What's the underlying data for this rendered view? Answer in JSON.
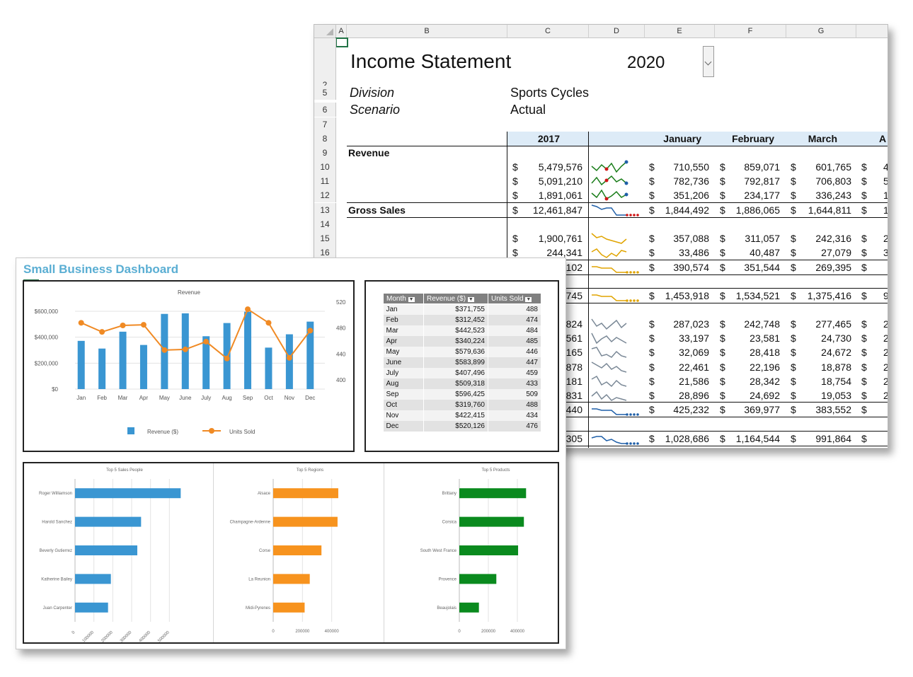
{
  "spreadsheet": {
    "columns": [
      "A",
      "B",
      "C",
      "D",
      "E",
      "F",
      "G"
    ],
    "title": "Income Statement",
    "year": "2020",
    "division_label": "Division",
    "division_value": "Sports Cycles",
    "scenario_label": "Scenario",
    "scenario_value": "Actual",
    "row_numbers": [
      "2",
      "5",
      "6",
      "7",
      "8",
      "9",
      "10",
      "11",
      "12",
      "13",
      "14",
      "15",
      "16"
    ],
    "col_year": "2017",
    "months": [
      "January",
      "February",
      "March",
      "A"
    ],
    "revenue_label": "Revenue",
    "gross_sales_label": "Gross Sales",
    "currency": "$",
    "rows": [
      {
        "total": "5,479,576",
        "jan": "710,550",
        "feb": "859,071",
        "mar": "601,765",
        "apr": "4"
      },
      {
        "total": "5,091,210",
        "jan": "782,736",
        "feb": "792,817",
        "mar": "706,803",
        "apr": "5"
      },
      {
        "total": "1,891,061",
        "jan": "351,206",
        "feb": "234,177",
        "mar": "336,243",
        "apr": "1"
      },
      {
        "total": "12,461,847",
        "jan": "1,844,492",
        "feb": "1,886,065",
        "mar": "1,644,811",
        "apr": "1,"
      },
      {
        "total": "1,900,761",
        "jan": "357,088",
        "feb": "311,057",
        "mar": "242,316",
        "apr": "2"
      },
      {
        "total": "244,341",
        "jan": "33,486",
        "feb": "40,487",
        "mar": "27,079",
        "apr": "3"
      },
      {
        "total": "102",
        "jan": "390,574",
        "feb": "351,544",
        "mar": "269,395",
        "apr": ""
      },
      {
        "total": "745",
        "jan": "1,453,918",
        "feb": "1,534,521",
        "mar": "1,375,416",
        "apr": "9"
      },
      {
        "total": "824",
        "jan": "287,023",
        "feb": "242,748",
        "mar": "277,465",
        "apr": "2"
      },
      {
        "total": "561",
        "jan": "33,197",
        "feb": "23,581",
        "mar": "24,730",
        "apr": "2"
      },
      {
        "total": "165",
        "jan": "32,069",
        "feb": "28,418",
        "mar": "24,672",
        "apr": "2"
      },
      {
        "total": "878",
        "jan": "22,461",
        "feb": "22,196",
        "mar": "18,878",
        "apr": "2"
      },
      {
        "total": "181",
        "jan": "21,586",
        "feb": "28,342",
        "mar": "18,754",
        "apr": "2"
      },
      {
        "total": "831",
        "jan": "28,896",
        "feb": "24,692",
        "mar": "19,053",
        "apr": "2"
      },
      {
        "total": "440",
        "jan": "425,232",
        "feb": "369,977",
        "mar": "383,552",
        "apr": ""
      },
      {
        "total": "305",
        "jan": "1,028,686",
        "feb": "1,164,544",
        "mar": "991,864",
        "apr": ""
      }
    ]
  },
  "dashboard": {
    "title": "Small Business Dashboard",
    "table_headers": [
      "Month",
      "Revenue ($)",
      "Units Sold"
    ],
    "table_rows": [
      [
        "Jan",
        "$371,755",
        "488"
      ],
      [
        "Feb",
        "$312,452",
        "474"
      ],
      [
        "Mar",
        "$442,523",
        "484"
      ],
      [
        "Apr",
        "$340,224",
        "485"
      ],
      [
        "May",
        "$579,636",
        "446"
      ],
      [
        "June",
        "$583,899",
        "447"
      ],
      [
        "July",
        "$407,496",
        "459"
      ],
      [
        "Aug",
        "$509,318",
        "433"
      ],
      [
        "Sep",
        "$596,425",
        "509"
      ],
      [
        "Oct",
        "$319,760",
        "488"
      ],
      [
        "Nov",
        "$422,415",
        "434"
      ],
      [
        "Dec",
        "$520,126",
        "476"
      ]
    ]
  },
  "chart_data": [
    {
      "type": "bar",
      "title": "Revenue",
      "categories": [
        "Jan",
        "Feb",
        "Mar",
        "Apr",
        "May",
        "June",
        "July",
        "Aug",
        "Sep",
        "Oct",
        "Nov",
        "Dec"
      ],
      "series": [
        {
          "name": "Revenue ($)",
          "type": "bar",
          "color": "#3a96d2",
          "values": [
            371755,
            312452,
            442523,
            340224,
            579636,
            583899,
            407496,
            509318,
            596425,
            319760,
            422415,
            520126
          ]
        },
        {
          "name": "Units Sold",
          "type": "line",
          "axis": "secondary",
          "color": "#f08a24",
          "values": [
            488,
            474,
            484,
            485,
            446,
            447,
            459,
            433,
            509,
            488,
            434,
            476
          ]
        }
      ],
      "y_ticks": [
        "$0",
        "$200,000",
        "$400,000",
        "$600,000"
      ],
      "ylim": [
        0,
        600000
      ],
      "y2_ticks": [
        "400",
        "440",
        "480",
        "520"
      ],
      "y2lim": [
        400,
        520
      ],
      "grid": true,
      "legend": "bottom"
    },
    {
      "type": "bar",
      "orientation": "horizontal",
      "title": "Top 5 Sales People",
      "categories": [
        "Roger Williamson",
        "Harold Sanchez",
        "Beverly Gutierrez",
        "Katherine Bailey",
        "Juan Carpenter"
      ],
      "values": [
        560000,
        350000,
        330000,
        190000,
        175000
      ],
      "x_ticks": [
        "0",
        "100000",
        "200000",
        "300000",
        "400000",
        "500000"
      ],
      "xlim": [
        0,
        600000
      ],
      "color": "#3a96d2"
    },
    {
      "type": "bar",
      "orientation": "horizontal",
      "title": "Top 5 Regions",
      "categories": [
        "Alsace",
        "Champagne-Ardenne",
        "Corse",
        "La Reunion",
        "Midi-Pyrenes"
      ],
      "values": [
        445000,
        440000,
        330000,
        250000,
        215000
      ],
      "x_ticks": [
        "0",
        "200000",
        "400000"
      ],
      "xlim": [
        0,
        600000
      ],
      "color": "#f7931e"
    },
    {
      "type": "bar",
      "orientation": "horizontal",
      "title": "Top 5 Products",
      "categories": [
        "Brittany",
        "Corsica",
        "South West France",
        "Provence",
        "Beaujolais"
      ],
      "values": [
        460000,
        445000,
        405000,
        255000,
        135000
      ],
      "x_ticks": [
        "0",
        "200000",
        "400000"
      ],
      "xlim": [
        0,
        600000
      ],
      "color": "#0a8a1e"
    }
  ]
}
